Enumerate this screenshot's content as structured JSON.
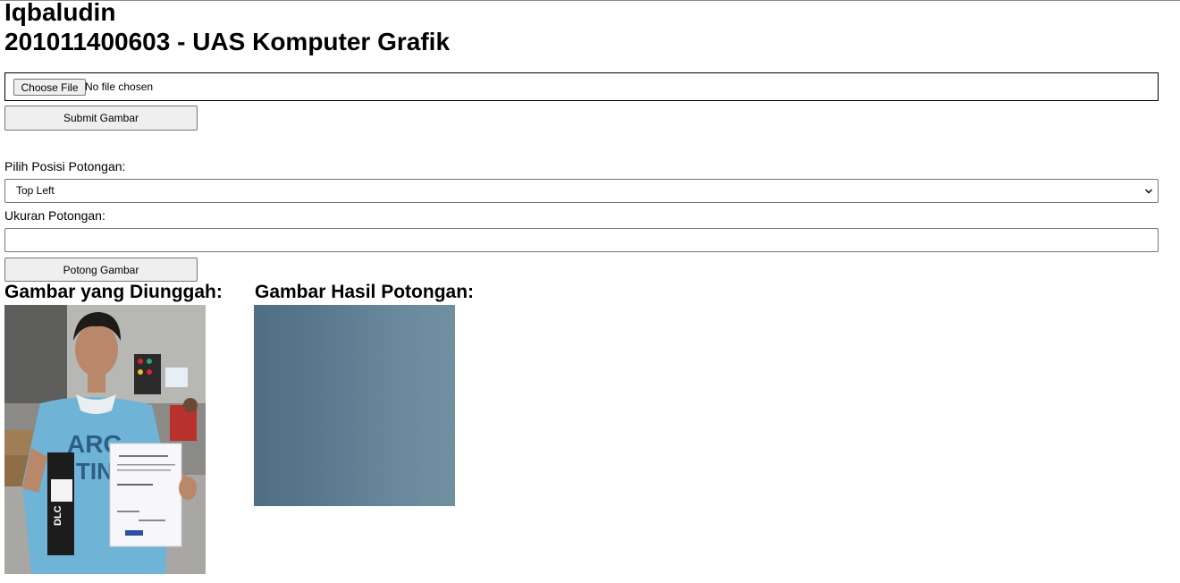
{
  "header": {
    "name": "Iqbaludin",
    "subtitle": "201011400603 - UAS Komputer Grafik"
  },
  "upload_form": {
    "choose_file_label": "Choose File",
    "file_status": "No file chosen",
    "submit_label": "Submit Gambar"
  },
  "crop_form": {
    "position_label": "Pilih Posisi Potongan:",
    "position_selected": "Top Left",
    "size_label": "Ukuran Potongan:",
    "size_value": "",
    "crop_button_label": "Potong Gambar"
  },
  "results": {
    "uploaded_heading": "Gambar yang Diunggah:",
    "cropped_heading": "Gambar Hasil Potongan:"
  }
}
